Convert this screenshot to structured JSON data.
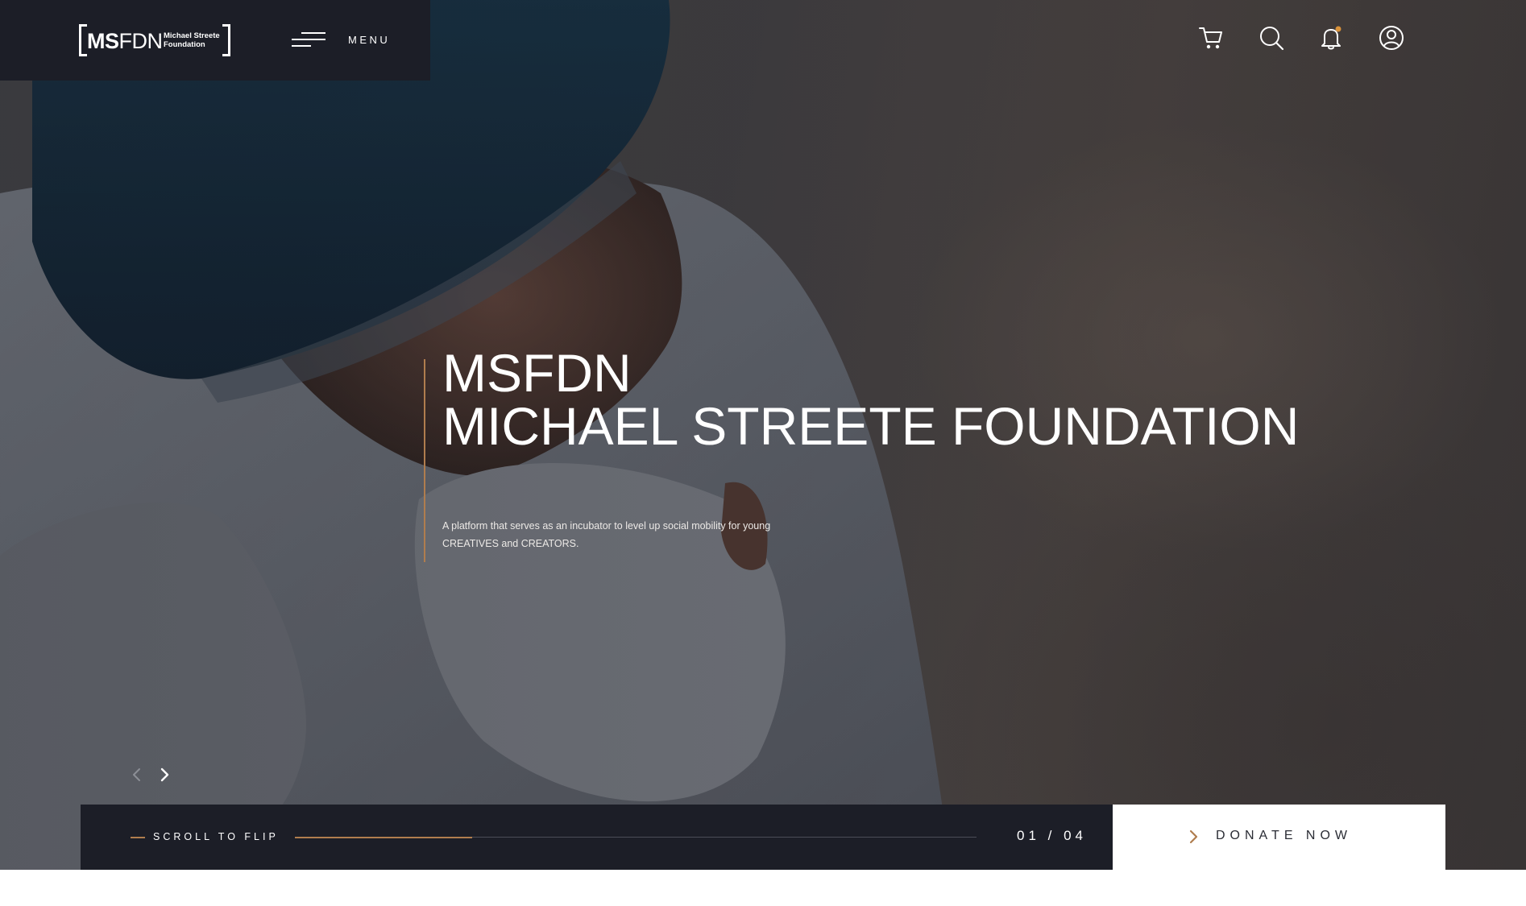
{
  "brand": {
    "mark_bold": "MS",
    "mark_light": "FDN",
    "sub": "Michael Streete\nFoundation"
  },
  "nav": {
    "menu_label": "MENU",
    "icons": [
      "cart-icon",
      "search-icon",
      "bell-icon",
      "user-icon"
    ],
    "notification_dot_color": "#d9923a"
  },
  "hero": {
    "title_line1": "MSFDN",
    "title_line2": "MICHAEL STREETE FOUNDATION",
    "subtitle": "A platform that serves as an incubator to level up social mobility for young CREATIVES and CREATORS.",
    "accent_color": "#b07d4e"
  },
  "slider": {
    "scroll_label": "SCROLL TO FLIP",
    "current": "01",
    "total": "04",
    "counter_text": "01 / 04",
    "progress": 0.26
  },
  "cta": {
    "donate_label": "DONATE NOW"
  }
}
